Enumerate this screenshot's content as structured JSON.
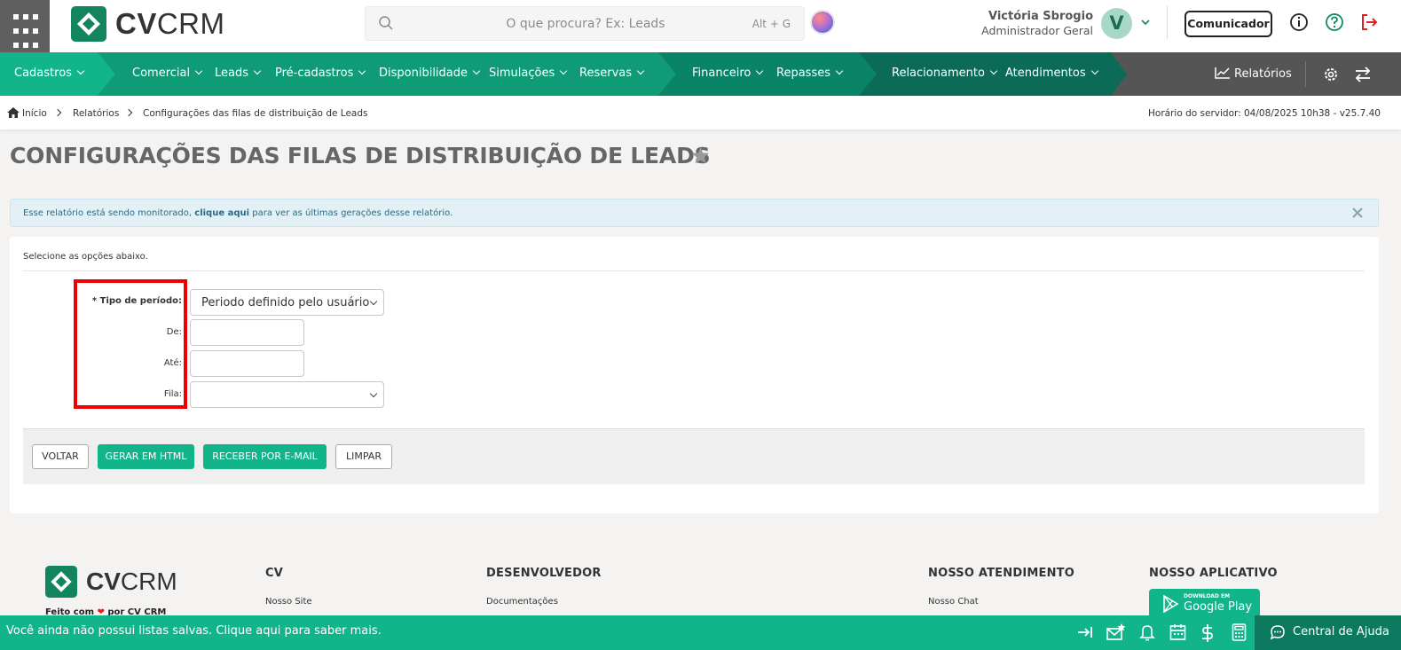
{
  "header": {
    "logo": {
      "bold": "CV",
      "light": "CRM"
    },
    "search": {
      "placeholder": "O que procura? Ex: Leads",
      "shortcut": "Alt + G"
    },
    "user": {
      "name": "Victória Sbrogio",
      "role": "Administrador Geral",
      "initial": "V"
    },
    "communicator_label": "Comunicador"
  },
  "nav": {
    "groups": [
      {
        "color": "#12b58a",
        "items": [
          "Cadastros"
        ]
      },
      {
        "color": "#0e9b76",
        "items": [
          "Comercial",
          "Leads",
          "Pré-cadastros",
          "Disponibilidade",
          "Simulações",
          "Reservas"
        ]
      },
      {
        "color": "#0a8467",
        "items": [
          "Financeiro",
          "Repasses"
        ]
      },
      {
        "color": "#0b6b57",
        "items": [
          "Relacionamento",
          "Atendimentos"
        ]
      }
    ],
    "reports_label": "Relatórios"
  },
  "breadcrumb": {
    "items": [
      "Início",
      "Relatórios",
      "Configurações das filas de distribuição de Leads"
    ],
    "server_time": "Horário do servidor: 04/08/2025 10h38 - v25.7.40"
  },
  "page": {
    "title": "CONFIGURAÇÕES DAS FILAS DE DISTRIBUIÇÃO DE LEADS",
    "alert": {
      "prefix": "Esse relatório está sendo monitorado, ",
      "link": "clique aqui",
      "suffix": " para ver as últimas gerações desse relatório."
    },
    "intro": "Selecione as opções abaixo.",
    "form": {
      "period_type_label": "* Tipo de período:",
      "period_type_value": "Periodo definido pelo usuário",
      "from_label": "De:",
      "from_value": "",
      "to_label": "Até:",
      "to_value": "",
      "queue_label": "Fila:",
      "queue_value": ""
    },
    "buttons": {
      "back": "VOLTAR",
      "html": "GERAR EM HTML",
      "email": "RECEBER POR E-MAIL",
      "clear": "LIMPAR"
    }
  },
  "footer": {
    "made_with": "Feito com",
    "made_by": "por CV CRM",
    "columns": [
      {
        "title": "CV",
        "link": "Nosso Site"
      },
      {
        "title": "DESENVOLVEDOR",
        "link": "Documentações"
      },
      {
        "title": "NOSSO ATENDIMENTO",
        "link": "Nosso Chat"
      },
      {
        "title": "NOSSO APLICATIVO"
      }
    ],
    "google_play": {
      "small": "DOWNLOAD EM",
      "big": "Google Play"
    }
  },
  "bottom_bar": {
    "message": "Você ainda não possui listas salvas. Clique aqui para saber mais.",
    "help_label": "Central de Ajuda"
  },
  "colors": {
    "brand_green": "#12b58a",
    "highlight_red": "#e00000"
  }
}
